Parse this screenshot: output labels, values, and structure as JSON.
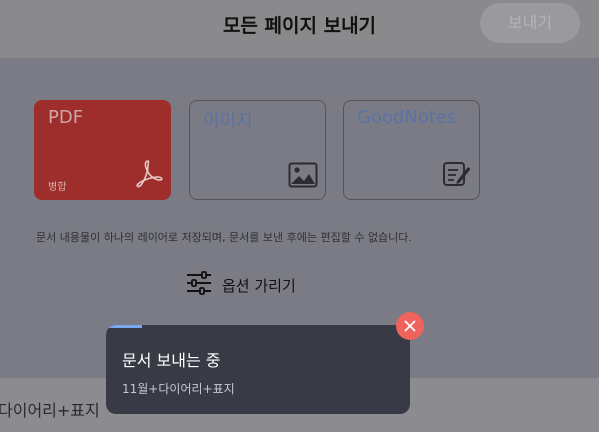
{
  "header": {
    "title": "모든 페이지 보내기",
    "send_label": "보내기"
  },
  "formats": [
    {
      "label": "PDF",
      "sub": "병합",
      "icon": "pdf-icon",
      "selected": true
    },
    {
      "label": "이미지",
      "icon": "image-icon",
      "selected": false
    },
    {
      "label": "GoodNotes",
      "icon": "goodnotes-note-icon",
      "selected": false
    }
  ],
  "description": "문서 내용물이 하나의 레이어로 저장되며, 문서를 보낸 후에는 편집할 수 없습니다.",
  "options": {
    "label": "옵션 가리기",
    "icon": "sliders-icon"
  },
  "document": {
    "name": "다이어리+표지"
  },
  "toast": {
    "title": "문서 보내는 중",
    "subtitle": "11월+다이어리+표지",
    "progress": 0.12,
    "close_icon": "close-icon"
  },
  "colors": {
    "pdf_selected": "#9e2e2c",
    "link_text": "#5a72a6",
    "toast_bg": "#383b45",
    "close_button": "#f0625c",
    "progress": "#7aa8f0"
  }
}
